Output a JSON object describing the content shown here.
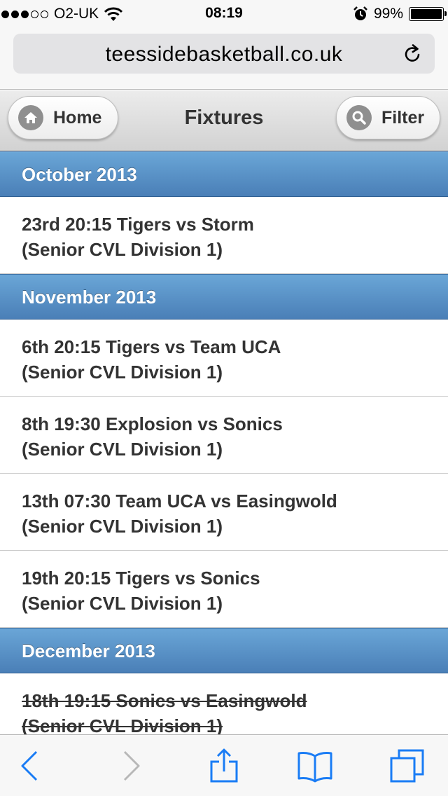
{
  "status_bar": {
    "carrier": "O2-UK",
    "time": "08:19",
    "battery": "99%",
    "battery_level": 0.99,
    "signal_bars_filled": 3,
    "signal_bars_total": 5
  },
  "url_bar": {
    "url": "teessidebasketball.co.uk"
  },
  "header": {
    "title": "Fixtures",
    "home_label": "Home",
    "filter_label": "Filter"
  },
  "groups": [
    {
      "month": "October 2013",
      "fixtures": [
        {
          "line1": "23rd 20:15 Tigers vs Storm",
          "line2": "(Senior CVL Division 1)"
        }
      ]
    },
    {
      "month": "November 2013",
      "fixtures": [
        {
          "line1": "6th 20:15 Tigers vs Team UCA",
          "line2": "(Senior CVL Division 1)"
        },
        {
          "line1": "8th 19:30 Explosion vs Sonics",
          "line2": "(Senior CVL Division 1)"
        },
        {
          "line1": "13th 07:30 Team UCA vs Easingwold",
          "line2": "(Senior CVL Division 1)"
        },
        {
          "line1": "19th 20:15 Tigers vs Sonics",
          "line2": "(Senior CVL Division 1)"
        }
      ]
    },
    {
      "month": "December 2013",
      "fixtures": [
        {
          "line1": "18th 19:15 Sonics vs Easingwold",
          "line2": "(Senior CVL Division 1)",
          "struck": true
        }
      ]
    }
  ],
  "colors": {
    "divider_top": "#6aa6d7",
    "divider_bottom": "#4a7fb7",
    "ios_blue": "#1a7cf5",
    "text": "#333333"
  },
  "icons": {
    "home": "home-icon",
    "filter": "search-icon",
    "reload": "reload-icon",
    "back": "back-chevron-icon",
    "forward": "forward-chevron-icon",
    "share": "share-icon",
    "bookmarks": "bookmarks-icon",
    "tabs": "tabs-icon"
  }
}
